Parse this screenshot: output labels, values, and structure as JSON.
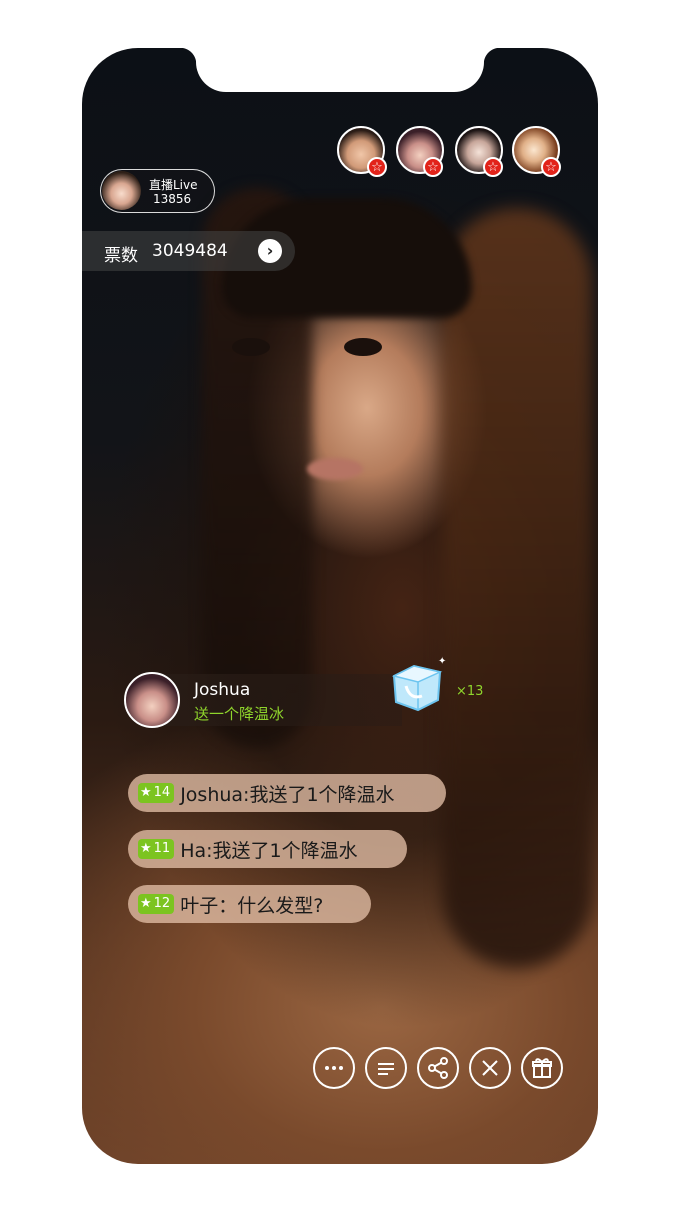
{
  "stream": {
    "host": {
      "title": "直播Live",
      "count": "13856"
    },
    "votes": {
      "label": "票数",
      "value": "3049484"
    },
    "viewers": [
      {
        "name": "viewer-1",
        "badge": "☆"
      },
      {
        "name": "viewer-2",
        "badge": "☆"
      },
      {
        "name": "viewer-3",
        "badge": "☆"
      },
      {
        "name": "viewer-4",
        "badge": "☆"
      }
    ]
  },
  "gift": {
    "user": "Joshua",
    "message": "送一个降温冰",
    "count": "×13"
  },
  "chat": [
    {
      "level": "14",
      "text": "Joshua:我送了1个降温水"
    },
    {
      "level": "11",
      "text": "Ha:我送了1个降温水"
    },
    {
      "level": "12",
      "text": "叶子：什么发型?"
    }
  ],
  "icons": {
    "comment": "comment-icon",
    "danmaku": "danmaku-icon",
    "share": "share-icon",
    "close": "close-icon",
    "gift": "gift-icon"
  },
  "colors": {
    "accent_green": "#8fd52c",
    "level_green": "#7cc420",
    "badge_red": "#e2231a"
  }
}
